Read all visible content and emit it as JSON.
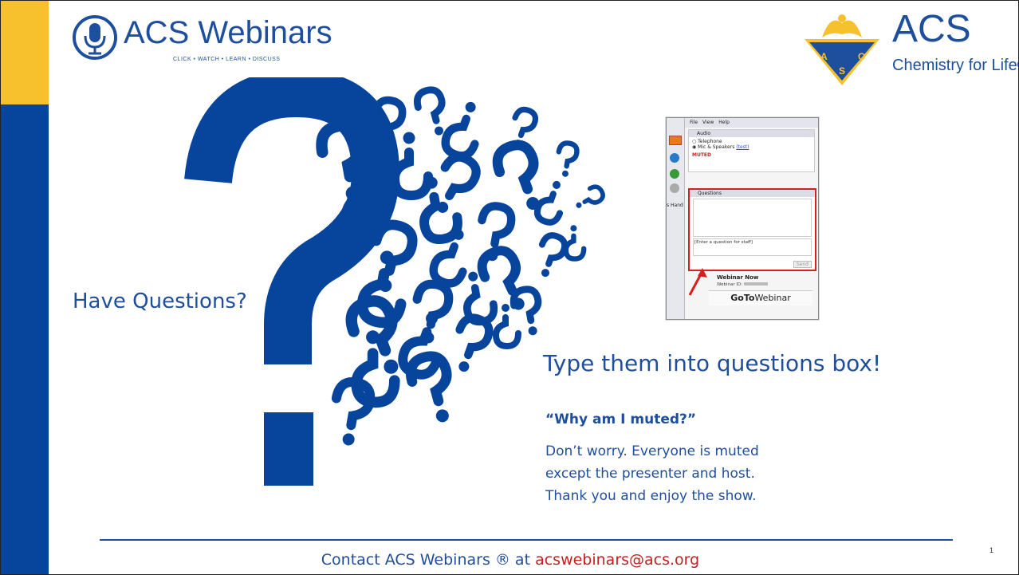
{
  "colors": {
    "brand_blue": "#07449b",
    "brand_yellow": "#f7c12e",
    "text_blue": "#1f4e9c",
    "email_red": "#c61f1f"
  },
  "header": {
    "left_logo": {
      "name": "ACS Webinars",
      "tagline": "CLICK • WATCH • LEARN • DISCUSS",
      "icon": "microphone-icon"
    },
    "right_logo": {
      "name": "ACS",
      "tagline": "Chemistry for Life®",
      "emblem": "acs-eagle-emblem"
    }
  },
  "main": {
    "have_questions": "Have Questions?",
    "type_them": "Type them into questions box!",
    "muted_title": "“Why am I muted?”",
    "muted_lines": [
      "Don’t worry. Everyone is muted",
      "except the presenter and host.",
      "Thank you and enjoy the show."
    ]
  },
  "goto_panel": {
    "menu": [
      "File",
      "View",
      "Help"
    ],
    "audio_header": "Audio",
    "audio_options": [
      "Telephone",
      "Mic & Speakers"
    ],
    "test_link": "(test)",
    "muted_label": "MUTED",
    "questions_header": "Questions",
    "question_placeholder": "[Enter a question for staff]",
    "send_label": "Send",
    "side_label": "s Hand",
    "webinar_title": "Webinar Now",
    "webinar_id_label": "Webinar ID:",
    "brand_goto": "GoTo",
    "brand_webinar": "Webinar"
  },
  "footer": {
    "prefix": "Contact ACS Webinars ® at ",
    "email": "acswebinars@acs.org",
    "page_number": "1"
  }
}
